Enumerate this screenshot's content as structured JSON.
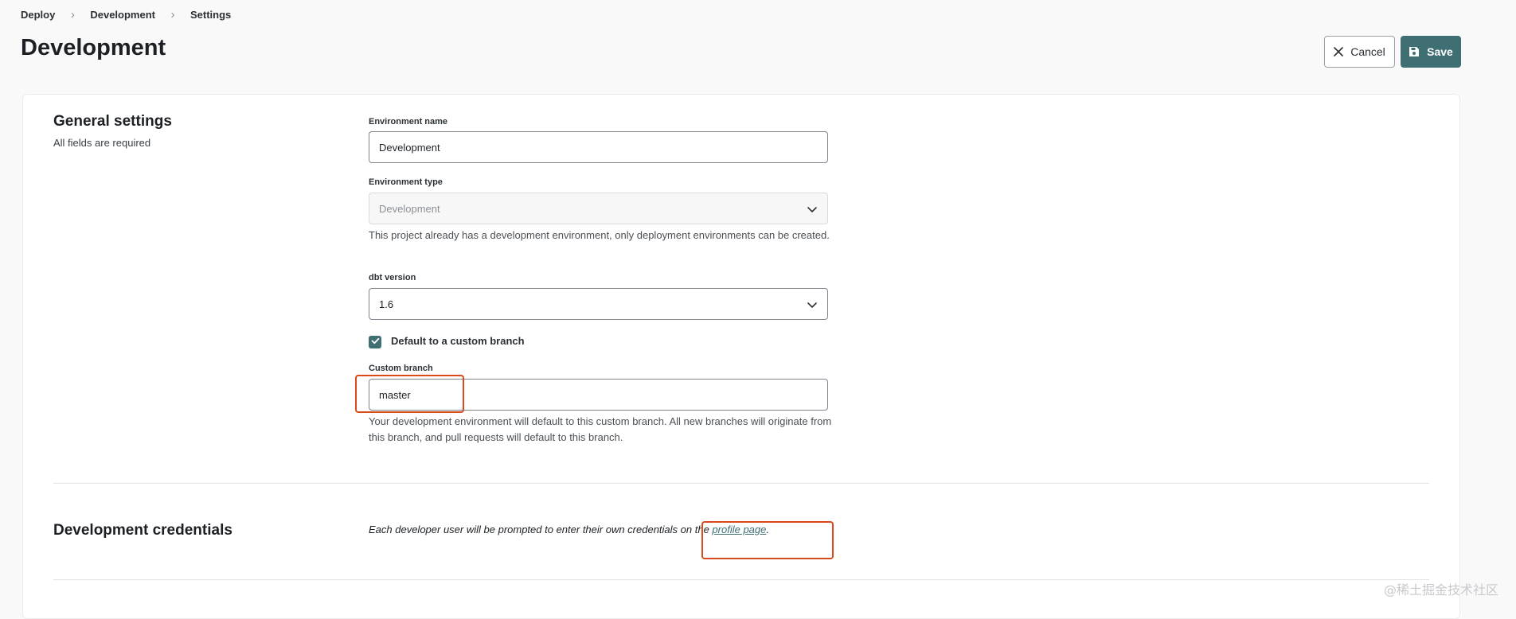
{
  "breadcrumb": {
    "items": [
      "Deploy",
      "Development",
      "Settings"
    ],
    "separator": ">"
  },
  "page": {
    "title": "Development"
  },
  "actions": {
    "cancel_label": "Cancel",
    "save_label": "Save"
  },
  "general": {
    "title": "General settings",
    "subtitle": "All fields are required",
    "env_name": {
      "label": "Environment name",
      "value": "Development"
    },
    "env_type": {
      "label": "Environment type",
      "value": "Development",
      "help": "This project already has a development environment, only deployment environments can be created.",
      "disabled": true
    },
    "dbt_version": {
      "label": "dbt version",
      "value": "1.6"
    },
    "custom_branch_toggle": {
      "label": "Default to a custom branch",
      "checked": true
    },
    "custom_branch": {
      "label": "Custom branch",
      "value": "master",
      "help": "Your development environment will default to this custom branch. All new branches will originate from this branch, and pull requests will default to this branch."
    }
  },
  "credentials": {
    "title": "Development credentials",
    "text_before": "Each developer user will be prompted to enter their own credentials on the ",
    "link_label": "profile page",
    "text_after": "."
  },
  "watermark": "@稀土掘金技术社区",
  "colors": {
    "accent": "#3f6f73",
    "highlight": "#d9491b",
    "background": "#f9f9f9"
  }
}
